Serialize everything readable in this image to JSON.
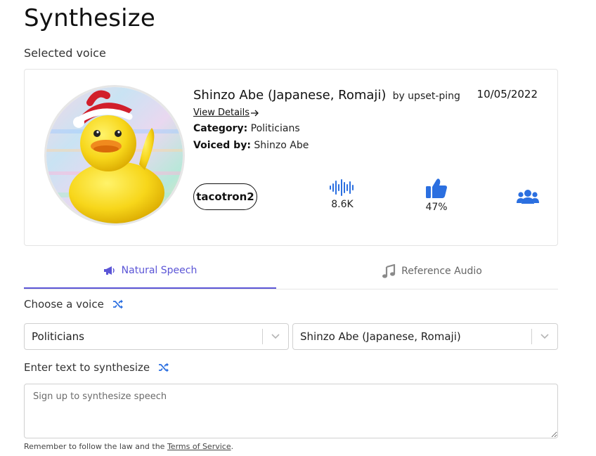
{
  "page": {
    "title": "Synthesize",
    "selected_voice_label": "Selected voice"
  },
  "voice": {
    "name": "Shinzo Abe (Japanese, Romaji)",
    "by": "by upset-ping",
    "date": "10/05/2022",
    "view_details": "View Details",
    "category_label": "Category:",
    "category": "Politicians",
    "voiced_by_label": "Voiced by:",
    "voiced_by": "Shinzo Abe",
    "model": "tacotron2",
    "uses": "8.6K",
    "rating": "47%",
    "icons": {
      "uses": "sound-wave-icon",
      "rating": "thumbs-up-icon",
      "group": "users-icon",
      "details": "arrow-right-icon"
    }
  },
  "tabs": [
    {
      "label": "Natural Speech",
      "icon": "megaphone-icon",
      "active": true
    },
    {
      "label": "Reference Audio",
      "icon": "music-note-icon",
      "active": false
    }
  ],
  "form": {
    "choose_voice_label": "Choose a voice",
    "category_select": "Politicians",
    "voice_select": "Shinzo Abe (Japanese, Romaji)",
    "text_label": "Enter text to synthesize",
    "text_placeholder": "Sign up to synthesize speech",
    "text_value": ""
  },
  "footer": {
    "text": "Remember to follow the law and the ",
    "link": "Terms of Service",
    "end": "."
  },
  "colors": {
    "accent": "#5b55d6",
    "icon_blue": "#2b6fe0",
    "active_tab": "#5b55d6"
  }
}
